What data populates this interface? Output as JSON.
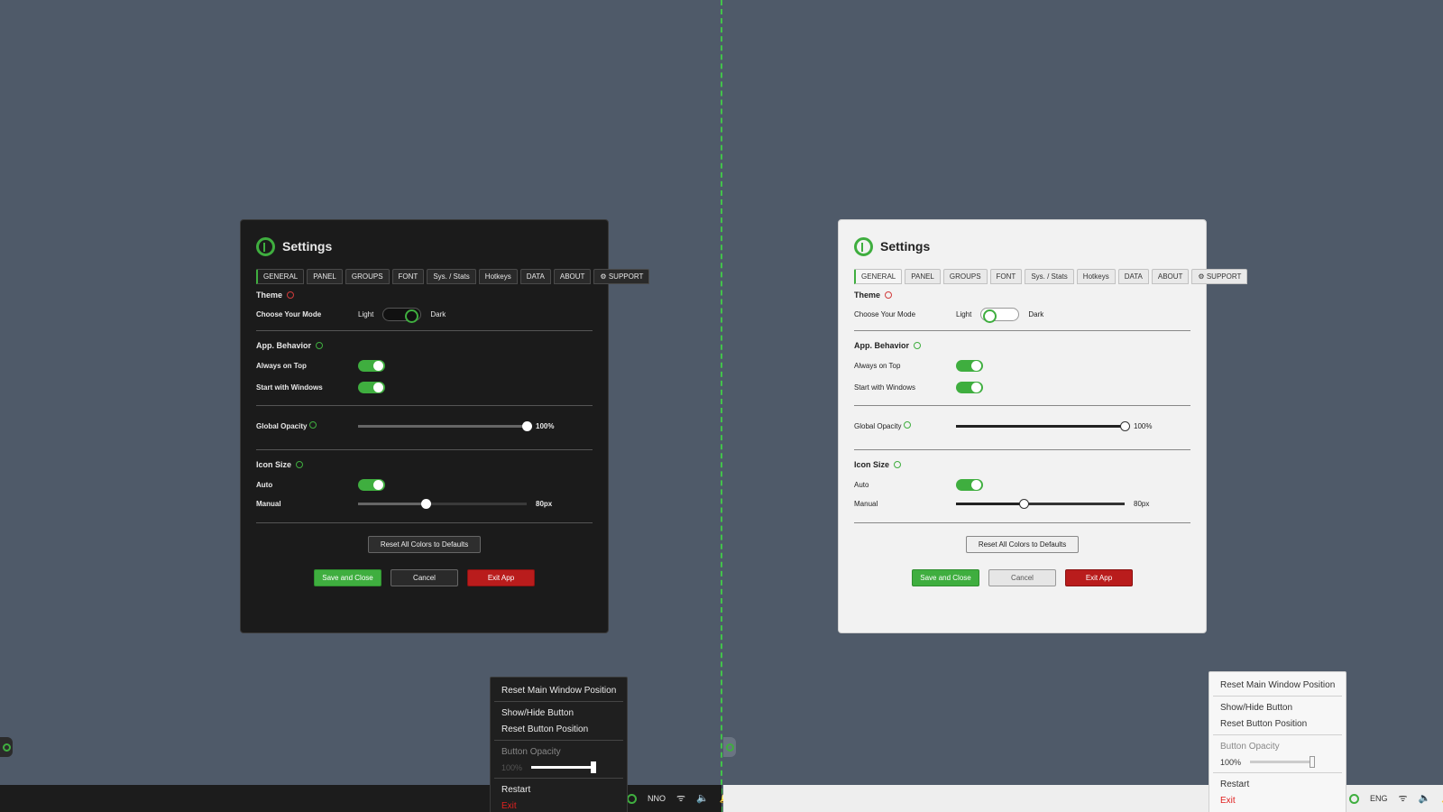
{
  "settings_dark": {
    "title": "Settings",
    "tabs": [
      "GENERAL",
      "PANEL",
      "GROUPS",
      "FONT",
      "Sys. / Stats",
      "Hotkeys",
      "DATA",
      "ABOUT",
      "SUPPORT"
    ],
    "active_tab": "GENERAL",
    "theme": {
      "heading": "Theme",
      "choose_mode_label": "Choose Your Mode",
      "light_label": "Light",
      "dark_label": "Dark",
      "mode": "dark"
    },
    "app_behavior": {
      "heading": "App. Behavior",
      "always_on_top_label": "Always on Top",
      "always_on_top": true,
      "start_with_windows_label": "Start with Windows",
      "start_with_windows": true
    },
    "global_opacity": {
      "label": "Global Opacity",
      "value_text": "100%",
      "value": 1.0
    },
    "icon_size": {
      "heading": "Icon Size",
      "auto_label": "Auto",
      "auto": true,
      "manual_label": "Manual",
      "manual_text": "80px",
      "manual_fraction": 0.4
    },
    "buttons": {
      "reset": "Reset All Colors to Defaults",
      "save": "Save and Close",
      "cancel": "Cancel",
      "exit": "Exit App"
    }
  },
  "settings_light": {
    "title": "Settings",
    "tabs": [
      "GENERAL",
      "PANEL",
      "GROUPS",
      "FONT",
      "Sys. / Stats",
      "Hotkeys",
      "DATA",
      "ABOUT",
      "SUPPORT"
    ],
    "active_tab": "GENERAL",
    "theme": {
      "heading": "Theme",
      "choose_mode_label": "Choose Your Mode",
      "light_label": "Light",
      "dark_label": "Dark",
      "mode": "light"
    },
    "app_behavior": {
      "heading": "App. Behavior",
      "always_on_top_label": "Always on Top",
      "always_on_top": true,
      "start_with_windows_label": "Start with Windows",
      "start_with_windows": true
    },
    "global_opacity": {
      "label": "Global Opacity",
      "value_text": "100%",
      "value": 1.0
    },
    "icon_size": {
      "heading": "Icon Size",
      "auto_label": "Auto",
      "auto": true,
      "manual_label": "Manual",
      "manual_text": "80px",
      "manual_fraction": 0.4
    },
    "buttons": {
      "reset": "Reset All Colors to Defaults",
      "save": "Save and Close",
      "cancel": "Cancel",
      "exit": "Exit App"
    }
  },
  "tray_menu_dark": {
    "reset_main": "Reset Main Window Position",
    "show_hide": "Show/Hide Button",
    "reset_button": "Reset Button Position",
    "opacity_label": "Button Opacity",
    "opacity_text": "100%",
    "restart": "Restart",
    "exit": "Exit"
  },
  "tray_menu_light": {
    "reset_main": "Reset Main Window Position",
    "show_hide": "Show/Hide Button",
    "reset_button": "Reset Button Position",
    "opacity_label": "Button Opacity",
    "opacity_text": "100%",
    "restart": "Restart",
    "exit": "Exit"
  },
  "taskbar_dark": {
    "lang": "NNO"
  },
  "taskbar_light": {
    "lang": "ENG"
  },
  "colors": {
    "accent": "#3fae3f",
    "danger": "#b91c1c",
    "desktop": "#4f5a69"
  }
}
